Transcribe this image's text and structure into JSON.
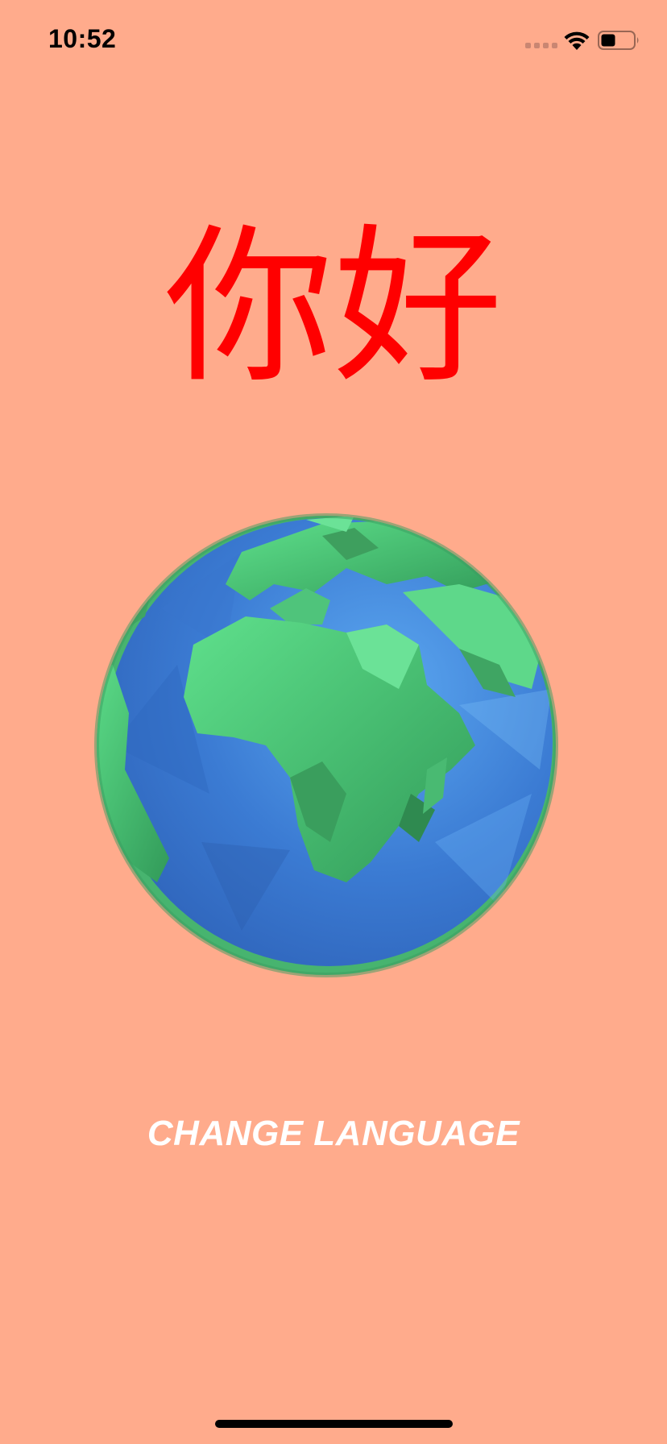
{
  "status_bar": {
    "time": "10:52",
    "icons": [
      "signal-icon",
      "wifi-icon",
      "battery-icon"
    ]
  },
  "main": {
    "greeting": "你好",
    "globe_icon": "earth-globe-icon",
    "change_language_label": "CHANGE LANGUAGE"
  },
  "colors": {
    "background": "#FFAB8C",
    "greeting": "#FF0000",
    "button_text": "#FFFFFF",
    "ocean": "#3F7FD6",
    "land": "#4CC277"
  }
}
